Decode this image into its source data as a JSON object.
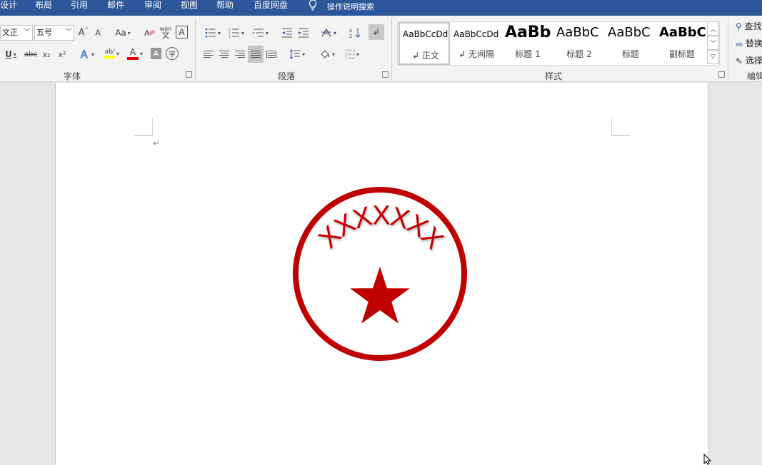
{
  "menubar": {
    "tabs": [
      "设计",
      "布局",
      "引用",
      "邮件",
      "审阅",
      "视图",
      "帮助",
      "百度网盘"
    ],
    "tell_me": "操作说明搜索",
    "tell_me_icon": "lightbulb-icon"
  },
  "ribbon": {
    "font": {
      "font_name": "文正",
      "font_size": "五号",
      "change_case": "Aa",
      "phonetic": "wén",
      "phonetic_char": "文",
      "border_char": "A",
      "subscript": "x₂",
      "superscript": "x²",
      "strike": "abc",
      "enclose": "字",
      "label": "字体",
      "font_color": "#e00000",
      "highlight_color": "#ffff00"
    },
    "paragraph": {
      "label": "段落"
    },
    "styles": {
      "label": "样式",
      "items": [
        {
          "preview": "AaBbCcDd",
          "name": "↲ 正文"
        },
        {
          "preview": "AaBbCcDd",
          "name": "↲ 无间隔"
        },
        {
          "preview": "AaBb",
          "name": "标题 1"
        },
        {
          "preview": "AaBbC",
          "name": "标题 2"
        },
        {
          "preview": "AaBbC",
          "name": "标题"
        },
        {
          "preview": "AaBbC",
          "name": "副标题"
        }
      ]
    },
    "editing": {
      "label": "编辑",
      "find": "查找",
      "replace": "替换",
      "select": "选择"
    }
  },
  "document": {
    "paragraph_mark": "↵",
    "seal": {
      "text": "XXXXXXX",
      "color": "#c00000",
      "center_icon": "star-icon"
    }
  }
}
